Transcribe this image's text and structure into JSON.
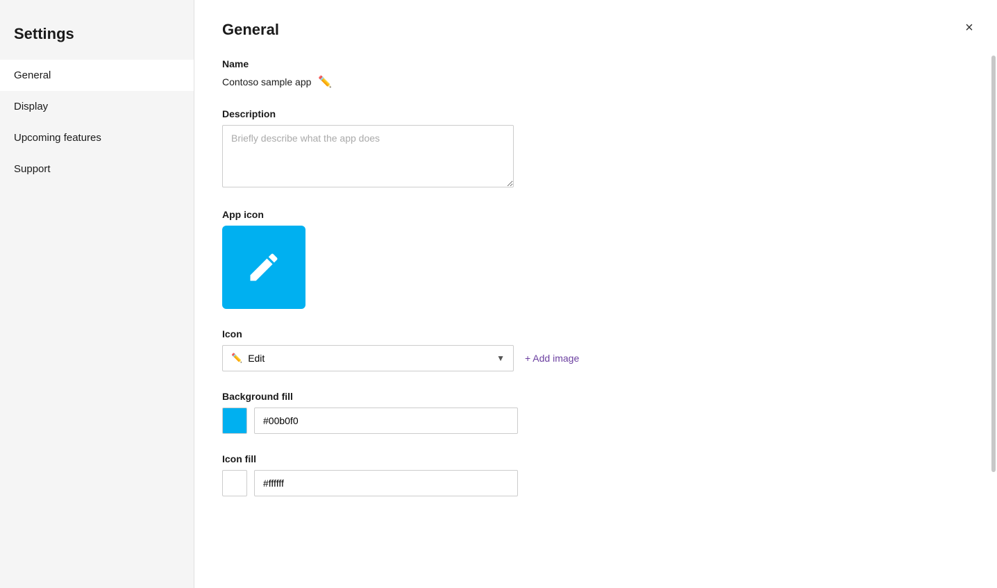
{
  "sidebar": {
    "title": "Settings",
    "items": [
      {
        "id": "general",
        "label": "General",
        "active": true
      },
      {
        "id": "display",
        "label": "Display",
        "active": false
      },
      {
        "id": "upcoming-features",
        "label": "Upcoming features",
        "active": false
      },
      {
        "id": "support",
        "label": "Support",
        "active": false
      }
    ]
  },
  "main": {
    "title": "General",
    "close_label": "×",
    "sections": {
      "name": {
        "label": "Name",
        "value": "Contoso sample app",
        "edit_tooltip": "Edit name"
      },
      "description": {
        "label": "Description",
        "placeholder": "Briefly describe what the app does"
      },
      "app_icon": {
        "label": "App icon",
        "bg_color": "#00b0f0"
      },
      "icon": {
        "label": "Icon",
        "selected_value": "Edit",
        "add_image_label": "+ Add image"
      },
      "background_fill": {
        "label": "Background fill",
        "color_value": "#00b0f0",
        "hex_value": "#00b0f0"
      },
      "icon_fill": {
        "label": "Icon fill",
        "color_value": "#ffffff",
        "hex_value": "#ffffff"
      }
    }
  }
}
